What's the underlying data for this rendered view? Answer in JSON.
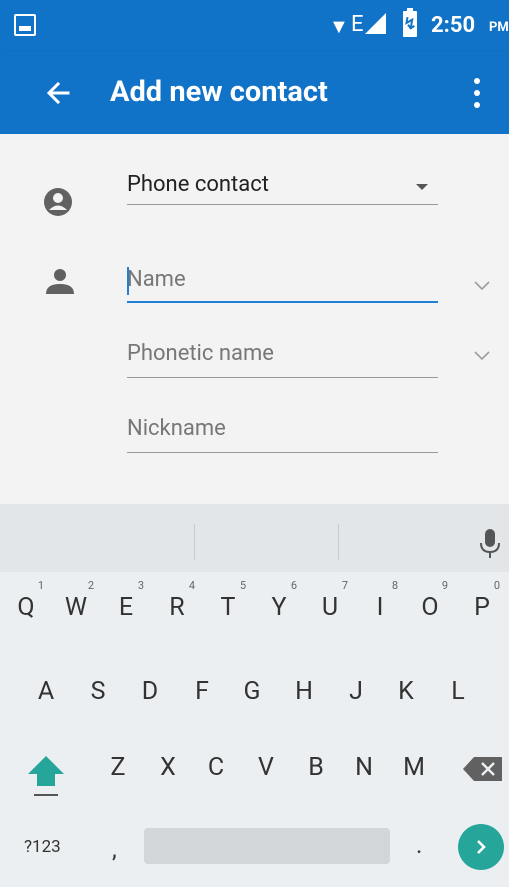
{
  "status_bar": {
    "network": "E",
    "time": "2:50",
    "ampm": "PM"
  },
  "app_bar": {
    "title": "Add new contact"
  },
  "form": {
    "account": "Phone contact",
    "name_hint": "Name",
    "phonetic_hint": "Phonetic name",
    "nickname_hint": "Nickname"
  },
  "keyboard": {
    "row1": [
      {
        "label": "Q",
        "num": "1"
      },
      {
        "label": "W",
        "num": "2"
      },
      {
        "label": "E",
        "num": "3"
      },
      {
        "label": "R",
        "num": "4"
      },
      {
        "label": "T",
        "num": "5"
      },
      {
        "label": "Y",
        "num": "6"
      },
      {
        "label": "U",
        "num": "7"
      },
      {
        "label": "I",
        "num": "8"
      },
      {
        "label": "O",
        "num": "9"
      },
      {
        "label": "P",
        "num": "0"
      }
    ],
    "row2": [
      "A",
      "S",
      "D",
      "F",
      "G",
      "H",
      "J",
      "K",
      "L"
    ],
    "row3": [
      "Z",
      "X",
      "C",
      "V",
      "B",
      "N",
      "M"
    ],
    "symbols": "?123",
    "comma": ",",
    "period": "."
  },
  "colors": {
    "primary": "#1173c7",
    "accent": "#26a69a",
    "focus_underline": "#1e7fd4"
  }
}
